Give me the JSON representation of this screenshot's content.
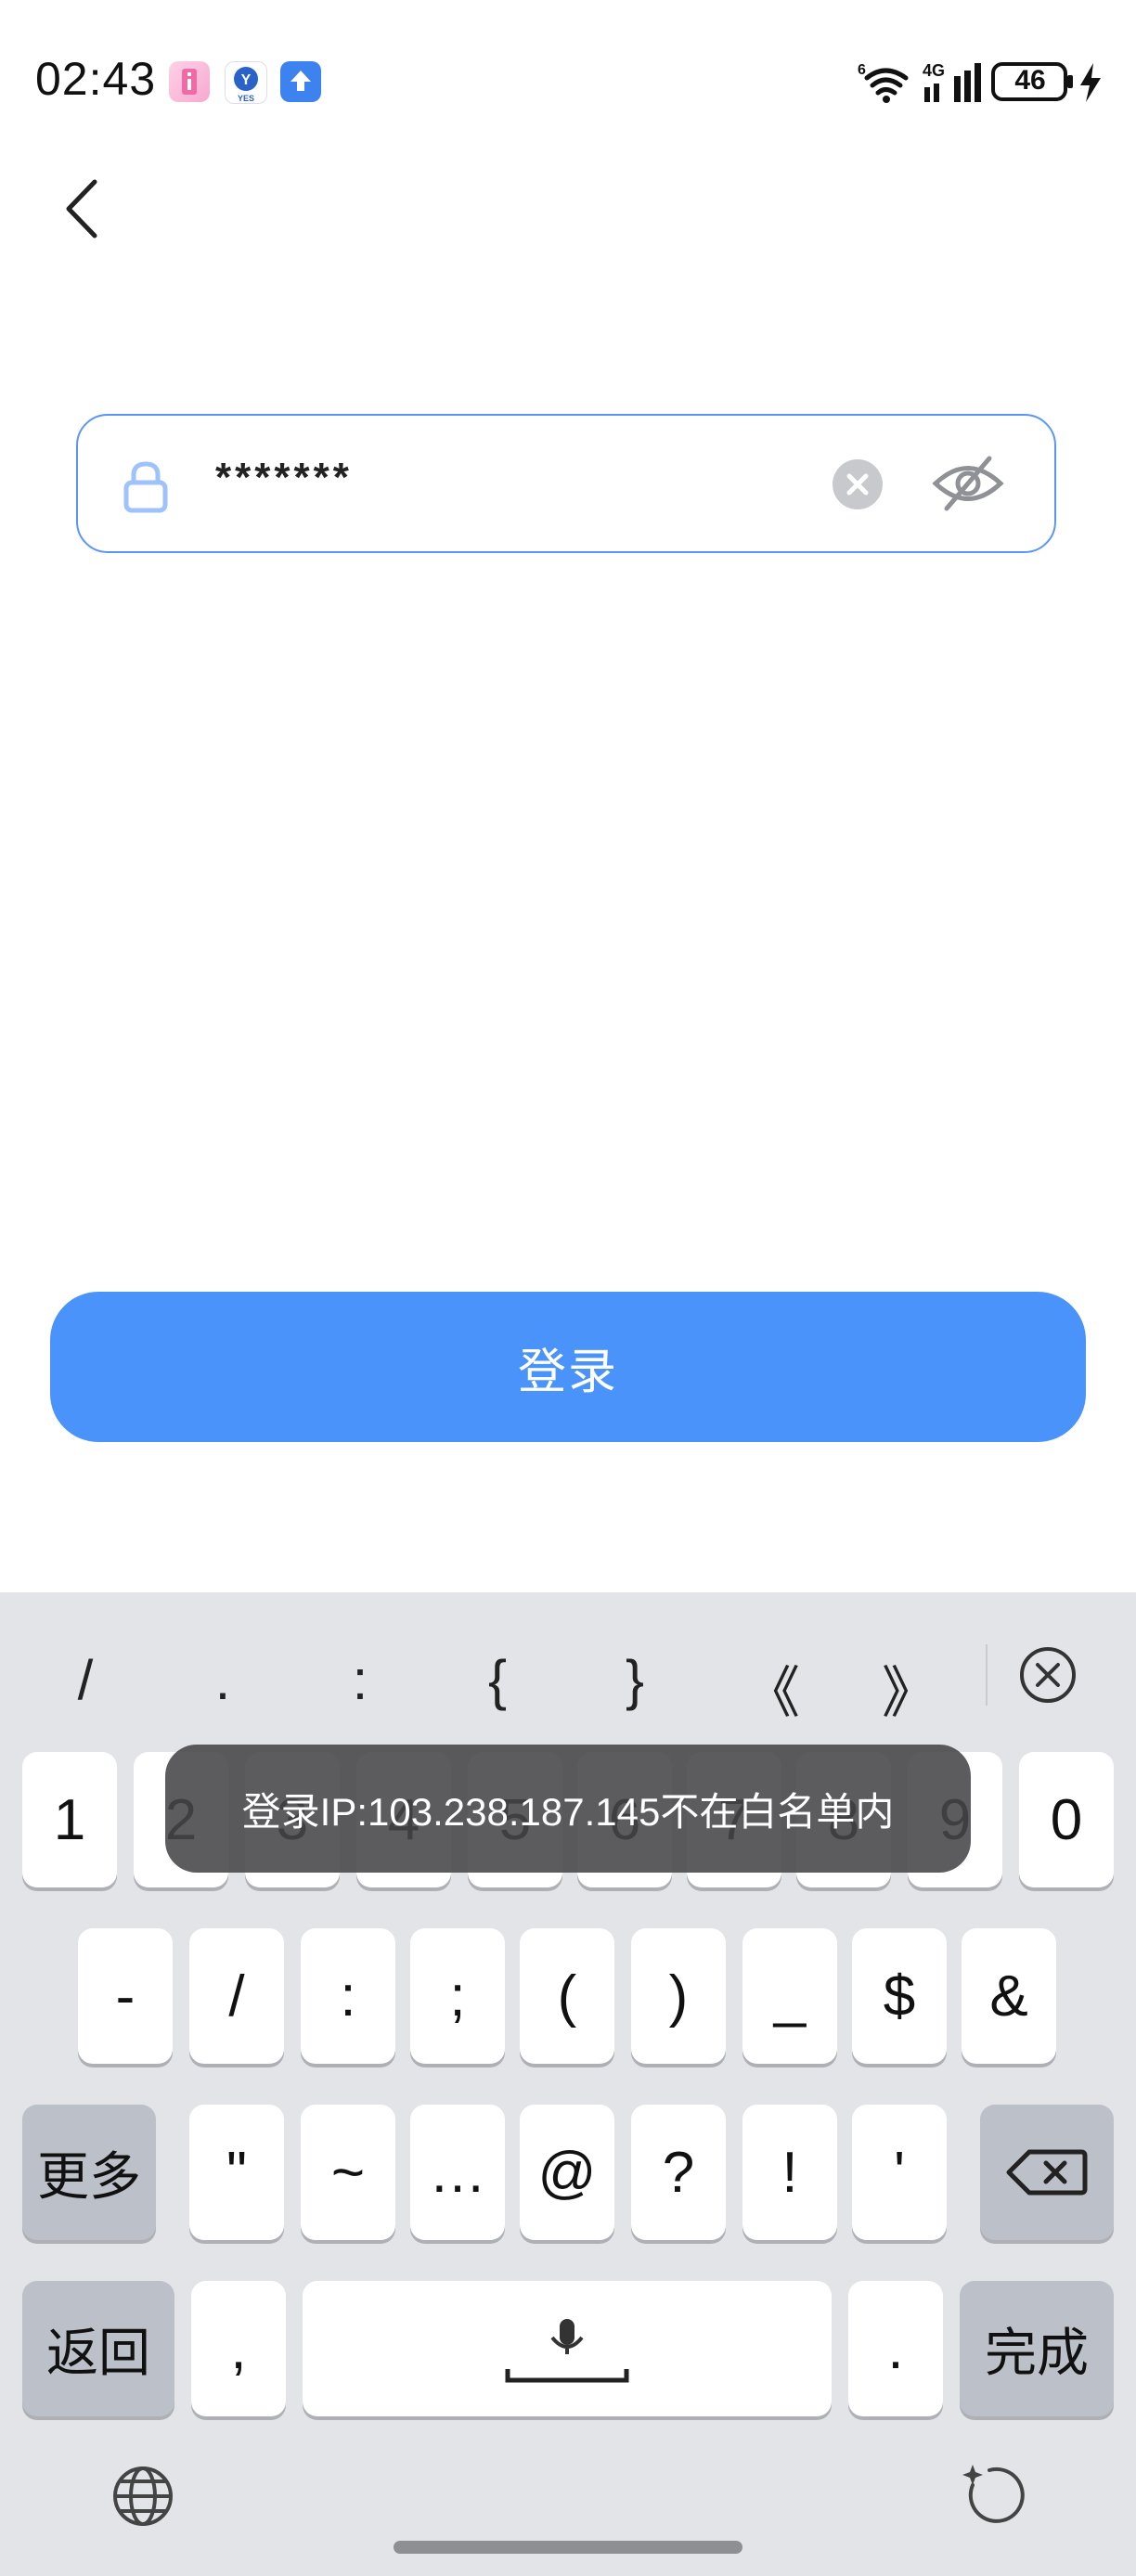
{
  "status_bar": {
    "time": "02:43",
    "notification_icons": [
      "info-app-icon",
      "yes-app-icon",
      "upload-app-icon"
    ],
    "network_label": "4G",
    "wifi_badge": "6",
    "battery": "46"
  },
  "form": {
    "password_value": "*******"
  },
  "login_button": "登录",
  "keyboard": {
    "symbol_bar": [
      "/",
      ".",
      ":",
      "{",
      "}",
      "《",
      "》"
    ],
    "row1": [
      "1",
      "2",
      "3",
      "4",
      "5",
      "6",
      "7",
      "8",
      "9",
      "0"
    ],
    "row2": [
      "-",
      "/",
      ":",
      ";",
      "(",
      ")",
      "_",
      "$",
      "&"
    ],
    "row3_left": "更多",
    "row3": [
      "\"",
      "~",
      "…",
      "@",
      "?",
      "!",
      "'"
    ],
    "row4_left": "返回",
    "row4_comma": ",",
    "row4_period": ".",
    "row4_done": "完成"
  },
  "toast": "登录IP:103.238.187.145不在白名单内",
  "colors": {
    "accent": "#4a93fb",
    "field_border": "#5b96f7",
    "keyboard_bg": "#e3e4e8",
    "key_dark": "#bcc0c8",
    "toast_bg": "#464648"
  }
}
